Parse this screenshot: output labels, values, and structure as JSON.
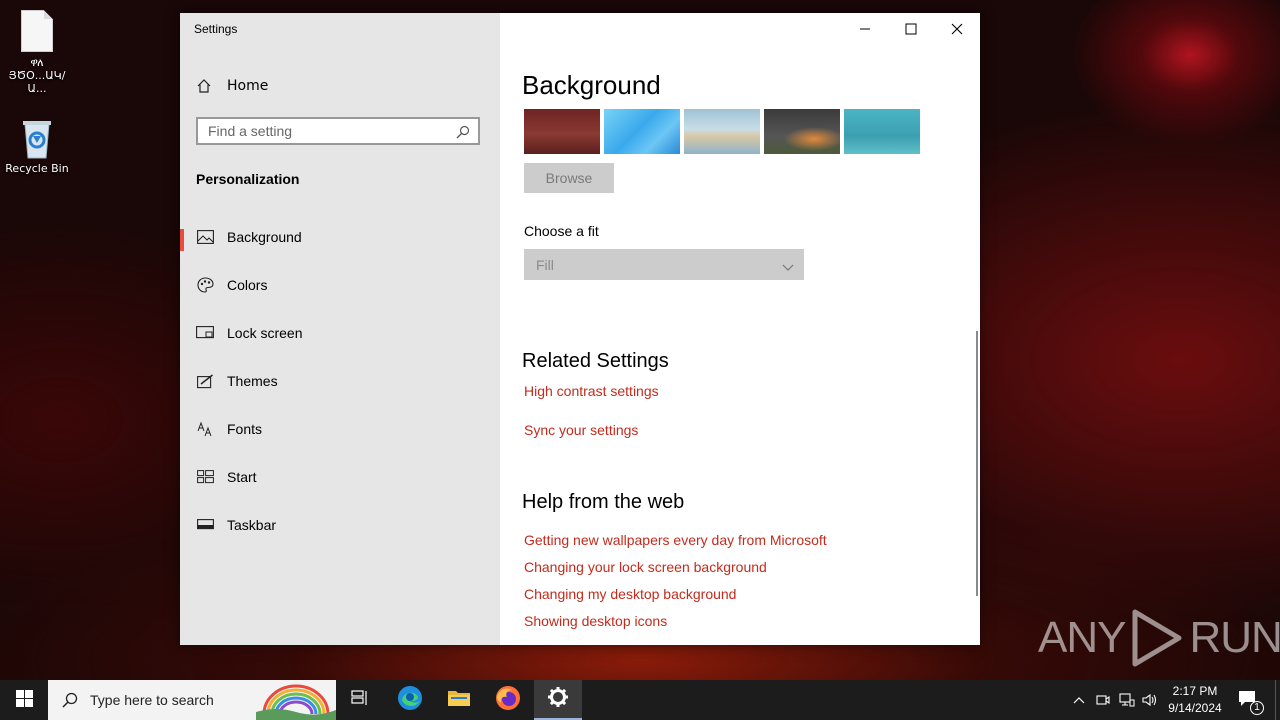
{
  "desktop": {
    "icons": [
      {
        "label_line1": "ዋለ",
        "label_line2": "ՅԾՕ...ԱԿ/Ա..."
      },
      {
        "label_line1": "Recycle Bin",
        "label_line2": ""
      }
    ]
  },
  "window": {
    "title": "Settings",
    "controls": {
      "minimize_icon": "minimize-icon",
      "maximize_icon": "maximize-icon",
      "close_icon": "close-icon"
    }
  },
  "sidebar": {
    "home_label": "Home",
    "search_placeholder": "Find a setting",
    "section_heading": "Personalization",
    "items": [
      {
        "label": "Background",
        "icon": "picture-icon",
        "active": true
      },
      {
        "label": "Colors",
        "icon": "palette-icon",
        "active": false
      },
      {
        "label": "Lock screen",
        "icon": "lock-screen-icon",
        "active": false
      },
      {
        "label": "Themes",
        "icon": "themes-icon",
        "active": false
      },
      {
        "label": "Fonts",
        "icon": "fonts-icon",
        "active": false
      },
      {
        "label": "Start",
        "icon": "start-icon",
        "active": false
      },
      {
        "label": "Taskbar",
        "icon": "taskbar-icon",
        "active": false
      }
    ]
  },
  "main": {
    "title": "Background",
    "thumbnails_count_shown": 5,
    "browse_label": "Browse",
    "fit_label": "Choose a fit",
    "fit_value": "Fill",
    "related_heading": "Related Settings",
    "related_links": [
      "High contrast settings",
      "Sync your settings"
    ],
    "help_heading": "Help from the web",
    "help_links": [
      "Getting new wallpapers every day from Microsoft",
      "Changing your lock screen background",
      "Changing my desktop background",
      "Showing desktop icons"
    ]
  },
  "watermark": {
    "left": "ANY",
    "right": "RUN"
  },
  "taskbar": {
    "search_placeholder": "Type here to search",
    "time": "2:17 PM",
    "date": "9/14/2024",
    "notification_count": "1"
  },
  "colors": {
    "accent": "#c42b1c",
    "active_indicator": "#e74c3c",
    "sidebar_bg": "#e6e6e6",
    "taskbar_bg": "#1c1c1c"
  }
}
